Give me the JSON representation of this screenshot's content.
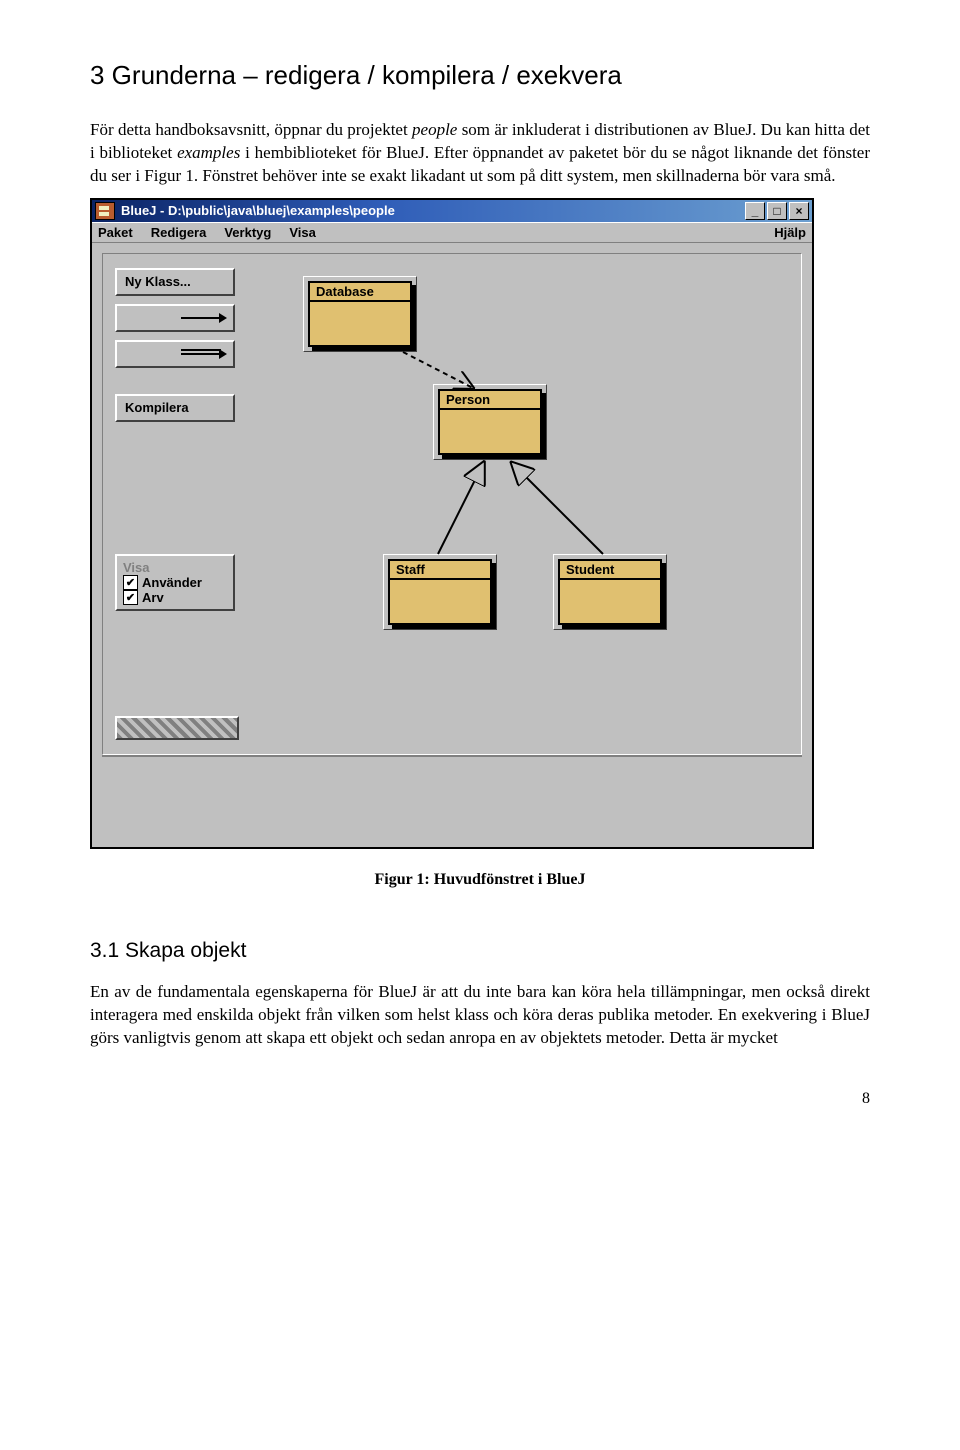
{
  "section": {
    "heading": "3  Grunderna – redigera / kompilera / exekvera",
    "para1_a": "För detta handboksavsnitt, öppnar du projektet ",
    "para1_b": "people",
    "para1_c": " som är inkluderat i distributionen av BlueJ. Du kan hitta det i biblioteket ",
    "para1_d": "examples",
    "para1_e": " i hembiblioteket för BlueJ. Efter öppnandet av paketet bör du se något liknande det fönster du ser i Figur 1. Fönstret behöver inte se exakt likadant ut som på ditt system, men skillnaderna bör vara små."
  },
  "window": {
    "title": "BlueJ - D:\\public\\java\\bluej\\examples\\people",
    "menu": {
      "paket": "Paket",
      "redigera": "Redigera",
      "verktyg": "Verktyg",
      "visa": "Visa",
      "help": "Hjälp"
    },
    "btn_min": "_",
    "btn_max": "□",
    "btn_close": "×",
    "tools": {
      "ny_klass": "Ny Klass...",
      "kompilera": "Kompilera"
    },
    "options": {
      "visa": "Visa",
      "anvander": "Använder",
      "arv": "Arv",
      "check": "✔"
    },
    "classes": {
      "database": "Database",
      "person": "Person",
      "staff": "Staff",
      "student": "Student"
    }
  },
  "figure_caption": "Figur 1: Huvudfönstret i BlueJ",
  "subsection": {
    "heading": "3.1  Skapa objekt",
    "para": "En av de fundamentala egenskaperna för BlueJ är att du inte bara kan köra hela tillämpningar, men också direkt interagera med enskilda objekt från vilken som helst klass och köra deras publika metoder. En exekvering i BlueJ görs vanligtvis genom att skapa ett objekt och sedan anropa en av objektets metoder. Detta är mycket"
  },
  "page_number": "8"
}
